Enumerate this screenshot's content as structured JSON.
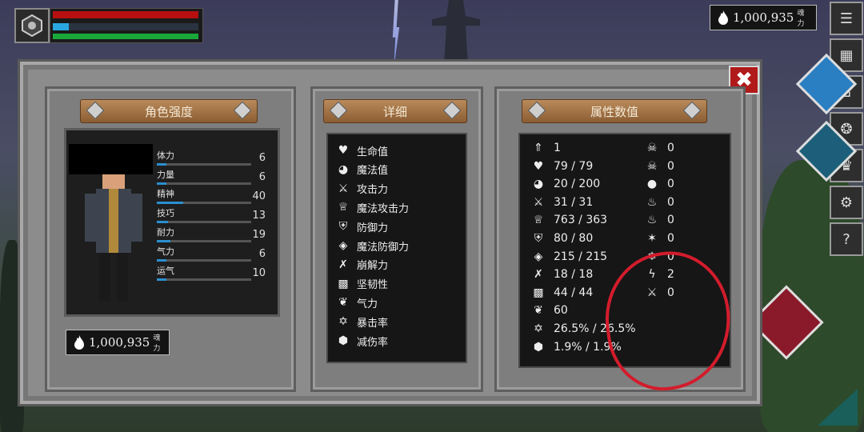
{
  "hud": {
    "portrait_icon": "guild-crest-icon",
    "bars": {
      "hp_fraction": 1.0,
      "mp_fraction": 0.11,
      "stamina_fraction": 1.0
    }
  },
  "currency_top": {
    "amount": "1,000,935",
    "unit": "魂力",
    "icon": "flame-icon"
  },
  "side_menu": [
    {
      "name": "menu-list-icon",
      "glyph": "☰"
    },
    {
      "name": "map-icon",
      "glyph": "▦"
    },
    {
      "name": "home-icon",
      "glyph": "⌂"
    },
    {
      "name": "skill-tree-icon",
      "glyph": "❂"
    },
    {
      "name": "crown-icon",
      "glyph": "♛"
    },
    {
      "name": "settings-gear-icon",
      "glyph": "⚙"
    },
    {
      "name": "help-icon",
      "glyph": "?"
    }
  ],
  "panels": {
    "character": {
      "title": "角色强度",
      "stats": [
        {
          "label": "体力",
          "value": "6",
          "fill": 0.1
        },
        {
          "label": "力量",
          "value": "6",
          "fill": 0.1
        },
        {
          "label": "精神",
          "value": "40",
          "fill": 0.28
        },
        {
          "label": "技巧",
          "value": "13",
          "fill": 0.12
        },
        {
          "label": "耐力",
          "value": "19",
          "fill": 0.14
        },
        {
          "label": "气力",
          "value": "6",
          "fill": 0.1
        },
        {
          "label": "运气",
          "value": "10",
          "fill": 0.1
        }
      ],
      "currency": {
        "amount": "1,000,935",
        "unit": "魂力"
      }
    },
    "details": {
      "title": "详细",
      "items": [
        {
          "label": "生命值",
          "icon": "heart-icon",
          "glyph": "♥"
        },
        {
          "label": "魔法值",
          "icon": "brain-icon",
          "glyph": "◕"
        },
        {
          "label": "攻击力",
          "icon": "sword-icon",
          "glyph": "⚔"
        },
        {
          "label": "魔法攻击力",
          "icon": "magic-crown-icon",
          "glyph": "♕"
        },
        {
          "label": "防御力",
          "icon": "shield-icon",
          "glyph": "⛨"
        },
        {
          "label": "魔法防御力",
          "icon": "magic-shield-icon",
          "glyph": "◈"
        },
        {
          "label": "崩解力",
          "icon": "break-icon",
          "glyph": "✗"
        },
        {
          "label": "坚韧性",
          "icon": "toughness-icon",
          "glyph": "▩"
        },
        {
          "label": "气力",
          "icon": "lungs-icon",
          "glyph": "❦"
        },
        {
          "label": "暴击率",
          "icon": "crit-star-icon",
          "glyph": "✡"
        },
        {
          "label": "减伤率",
          "icon": "damage-reduction-icon",
          "glyph": "⬢"
        }
      ]
    },
    "attributes": {
      "title": "属性数值",
      "left_values": [
        {
          "value": "1",
          "icon": "level-icon",
          "glyph": "⇑"
        },
        {
          "value": "79 / 79",
          "icon": "heart-icon",
          "glyph": "♥"
        },
        {
          "value": "20 / 200",
          "icon": "brain-icon",
          "glyph": "◕"
        },
        {
          "value": "31 / 31",
          "icon": "sword-icon",
          "glyph": "⚔"
        },
        {
          "value": "763 / 363",
          "icon": "magic-crown-icon",
          "glyph": "♕"
        },
        {
          "value": "80 / 80",
          "icon": "shield-icon",
          "glyph": "⛨"
        },
        {
          "value": "215 / 215",
          "icon": "magic-shield-icon",
          "glyph": "◈"
        },
        {
          "value": "18 / 18",
          "icon": "break-icon",
          "glyph": "✗"
        },
        {
          "value": "44 / 44",
          "icon": "toughness-icon",
          "glyph": "▩"
        },
        {
          "value": "60",
          "icon": "lungs-icon",
          "glyph": "❦"
        },
        {
          "value": "26.5% / 26.5%",
          "icon": "crit-star-icon",
          "glyph": "✡"
        },
        {
          "value": "1.9% / 1.9%",
          "icon": "damage-reduction-icon",
          "glyph": "⬢"
        }
      ],
      "right_values": [
        {
          "value": "0",
          "icon": "skull-icon",
          "glyph": "☠"
        },
        {
          "value": "0",
          "icon": "poison-skull-icon",
          "glyph": "☠"
        },
        {
          "value": "0",
          "icon": "bleed-drop-icon",
          "glyph": "●"
        },
        {
          "value": "0",
          "icon": "fire-icon",
          "glyph": "♨"
        },
        {
          "value": "0",
          "icon": "burn-icon",
          "glyph": "♨"
        },
        {
          "value": "0",
          "icon": "curse-icon",
          "glyph": "✶"
        },
        {
          "value": "0",
          "icon": "frost-icon",
          "glyph": "❄"
        },
        {
          "value": "2",
          "icon": "lightning-icon",
          "glyph": "ϟ"
        },
        {
          "value": "0",
          "icon": "broken-sword-icon",
          "glyph": "⚔"
        }
      ]
    }
  },
  "close_label": "✖"
}
